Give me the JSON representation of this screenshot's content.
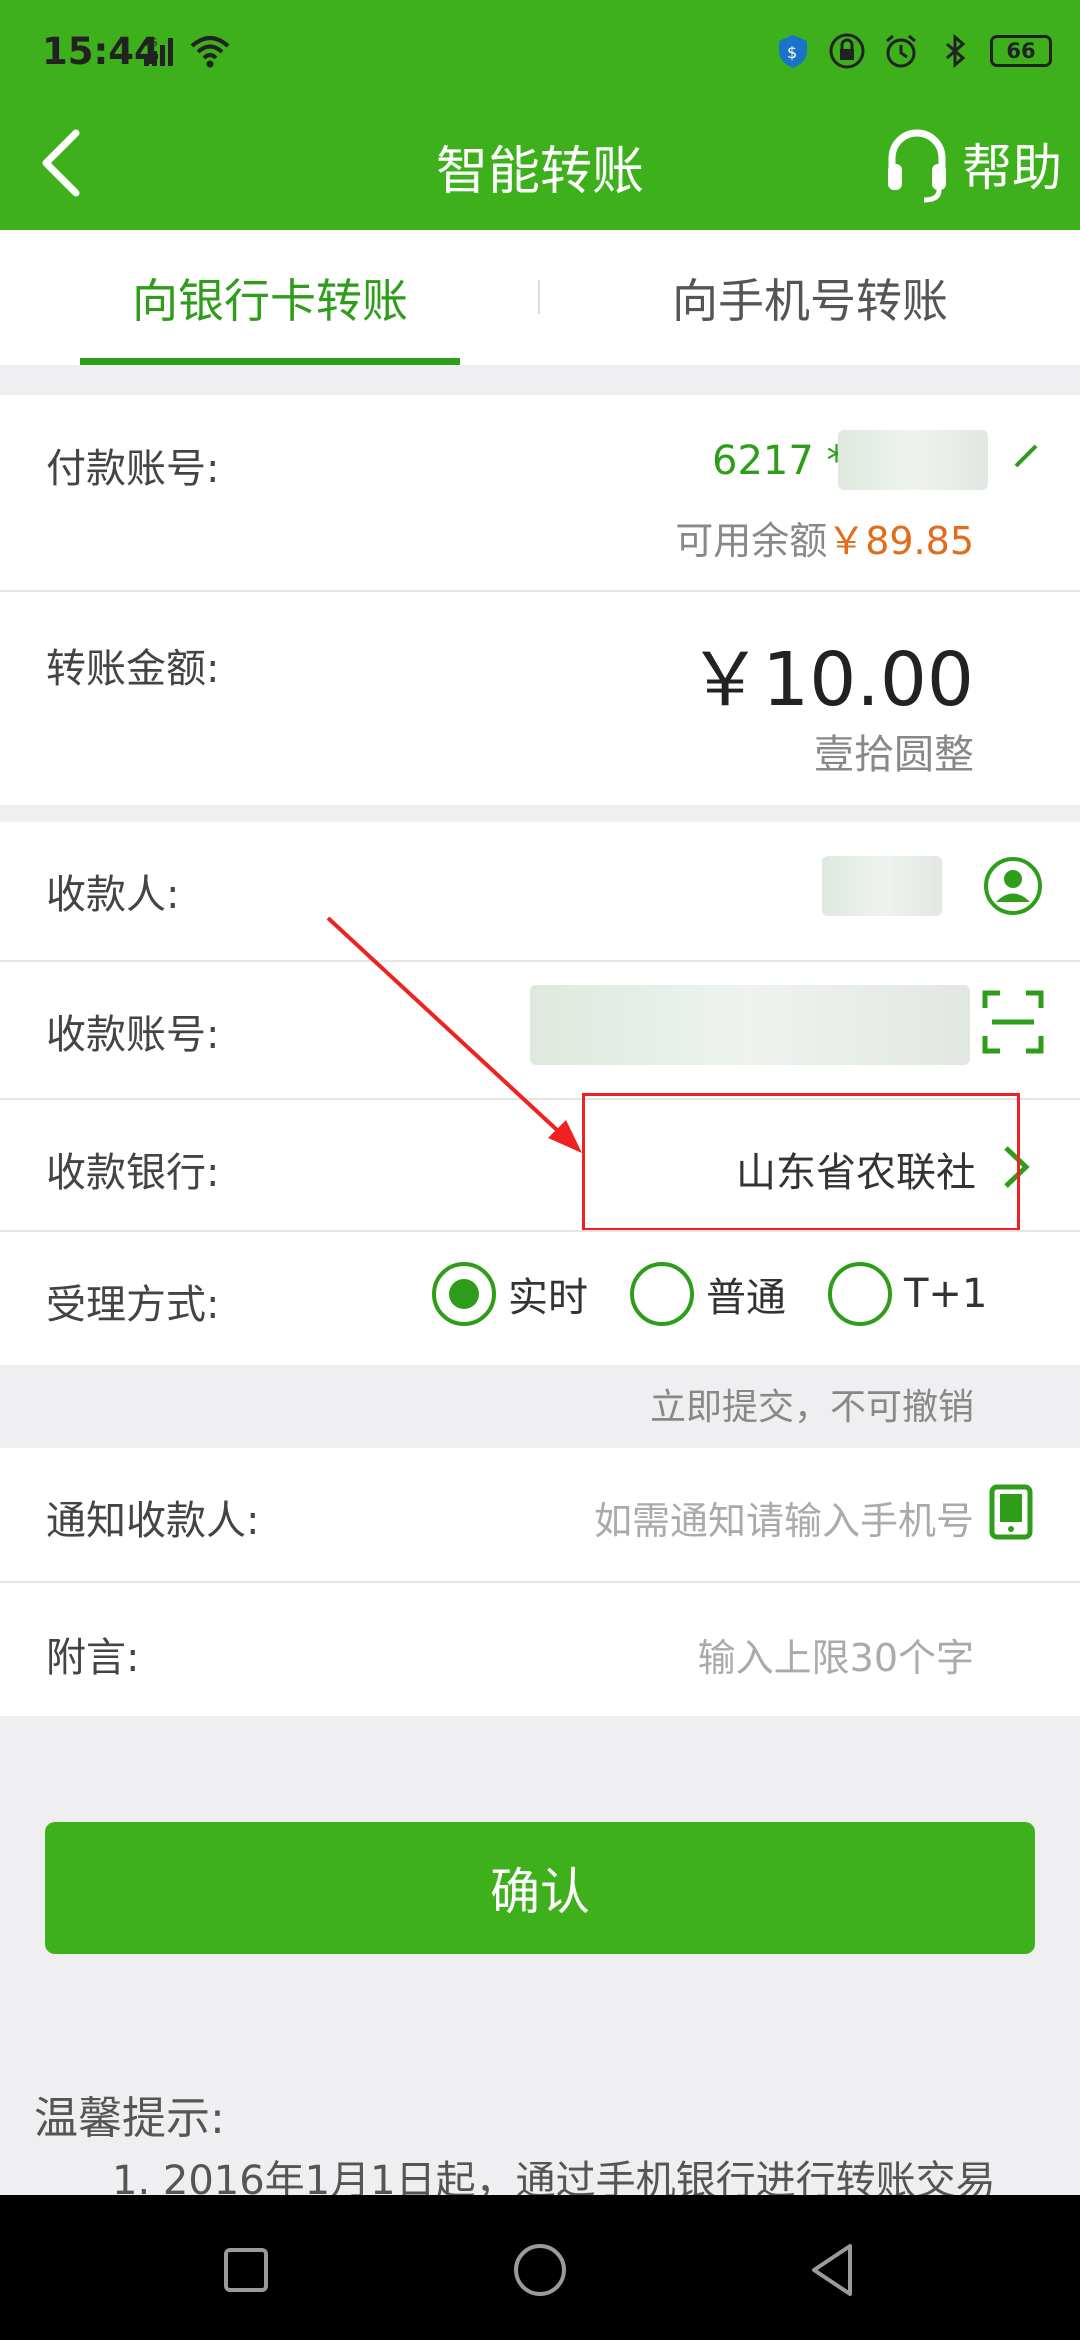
{
  "status_bar": {
    "time": "15:44",
    "network": "4G",
    "battery": "66"
  },
  "header": {
    "title": "智能转账",
    "help_label": "帮助"
  },
  "tabs": [
    {
      "label": "向银行卡转账",
      "active": true
    },
    {
      "label": "向手机号转账",
      "active": false
    }
  ],
  "payment": {
    "account_label": "付款账号:",
    "account_number": "6217 *",
    "balance_label": "可用余额",
    "balance_amount": "￥89.85"
  },
  "amount": {
    "label": "转账金额:",
    "value": "￥10.00",
    "in_words": "壹拾圆整"
  },
  "payee": {
    "name_label": "收款人:",
    "account_label": "收款账号:",
    "bank_label": "收款银行:",
    "bank_value": "山东省农联社"
  },
  "method": {
    "label": "受理方式:",
    "options": [
      {
        "label": "实时",
        "selected": true
      },
      {
        "label": "普通",
        "selected": false
      },
      {
        "label": "T+1",
        "selected": false
      }
    ],
    "note": "立即提交，不可撤销"
  },
  "notify": {
    "label": "通知收款人:",
    "placeholder": "如需通知请输入手机号"
  },
  "memo": {
    "label": "附言:",
    "placeholder": "输入上限30个字"
  },
  "confirm_label": "确认",
  "tips": {
    "title": "温馨提示:",
    "line1": "1. 2016年1月1日起，通过手机银行进行转账交易"
  },
  "colors": {
    "brand_green": "#3db01c",
    "accent_green": "#2e9d19",
    "balance_orange": "#e36c1b",
    "annotation_red": "#e22222"
  }
}
